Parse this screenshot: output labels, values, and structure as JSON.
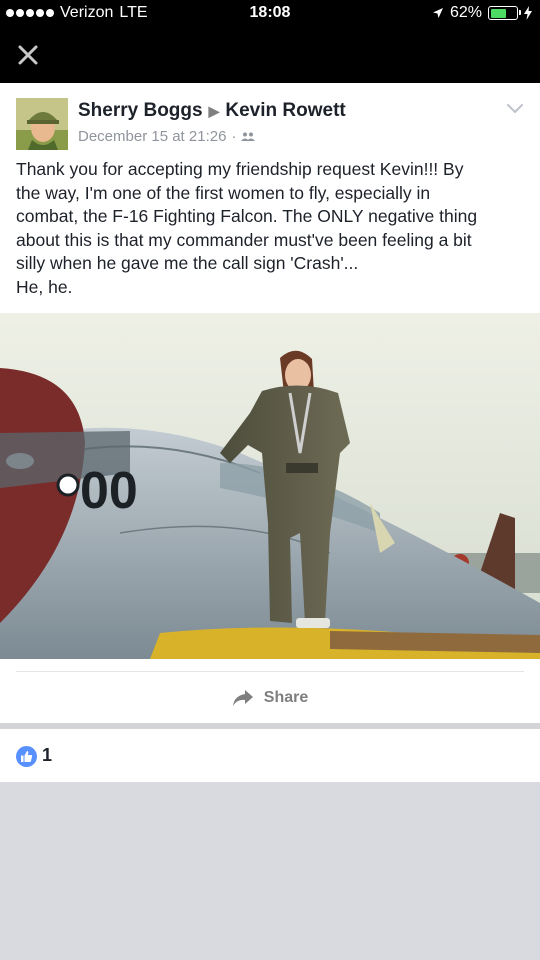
{
  "status_bar": {
    "carrier": "Verizon",
    "network": "LTE",
    "time": "18:08",
    "battery": "62%",
    "battery_level": 0.62,
    "signal_bars": 5
  },
  "post": {
    "author": "Sherry Boggs",
    "recipient": "Kevin Rowett",
    "date": "December 15 at 21:26",
    "separator": "·",
    "text_lines": [
      "Thank you for accepting my friendship request Kevin!!! By",
      "the way, I'm one of the first women to fly, especially in",
      "combat, the F-16 Fighting Falcon. The ONLY negative thing",
      "about this is that my commander must've been feeling a bit",
      "silly when he gave me the call sign 'Crash'...",
      "He, he."
    ],
    "share_label": "Share",
    "aircraft_number": "00"
  },
  "reactions": {
    "like_count": "1"
  },
  "icons": {
    "close": "close-icon",
    "chevron": "chevron-down-icon",
    "audience": "friends-icon",
    "share": "share-arrow-icon",
    "like": "thumbs-up-icon",
    "location": "location-arrow-icon",
    "charging": "lightning-icon"
  },
  "colors": {
    "like_blue": "#5890ff",
    "battery_green": "#4cd964",
    "text_dark": "#1d2129",
    "text_gray": "#90949c"
  }
}
